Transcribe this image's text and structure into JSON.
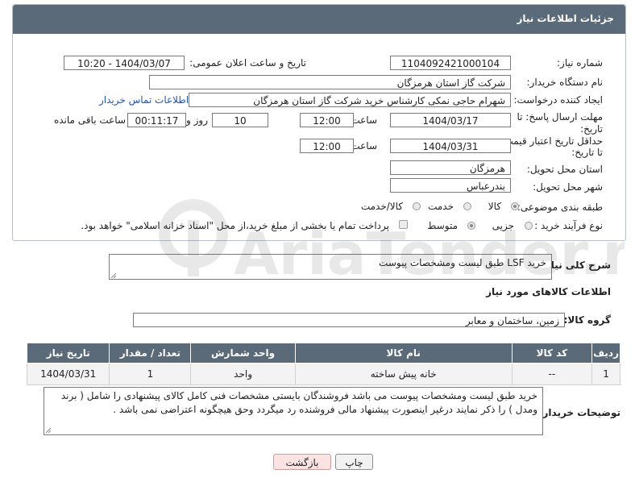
{
  "header": {
    "title": "جزئیات اطلاعات نیاز"
  },
  "fields": {
    "need_number_label": "شماره نیاز:",
    "need_number": "1104092421000104",
    "announce_label": "تاریخ و ساعت اعلان عمومی:",
    "announce_value": "1404/03/07 - 10:20",
    "buyer_org_label": "نام دستگاه خریدار:",
    "buyer_org": "شرکت گاز استان هرمزگان",
    "creator_label": "ایجاد کننده درخواست:",
    "creator": "شهرام حاجی نمکی کارشناس خرید شرکت گاز استان هرمزگان",
    "contact_link": "اطلاعات تماس خریدار",
    "deadline_label_1": "مهلت ارسال پاسخ: تا",
    "deadline_label_2": "تاریخ:",
    "deadline_date": "1404/03/17",
    "time_label": "ساعت",
    "deadline_time": "12:00",
    "days_value": "10",
    "days_label": "روز و",
    "remaining_value": "00:11:17",
    "remaining_label": "ساعت باقی مانده",
    "validity_label_1": "حداقل تاریخ اعتبار قیمت:",
    "validity_label_2": "تا تاریخ:",
    "validity_date": "1404/03/31",
    "validity_time": "12:00",
    "province_label": "استان محل تحویل:",
    "province": "هرمزگان",
    "city_label": "شهر محل تحویل:",
    "city": "بندرعباس",
    "category_label": "طبقه بندی موضوعی:",
    "category_options": [
      "کالا",
      "خدمت",
      "کالا/خدمت"
    ],
    "category_selected": "کالا",
    "process_label": "نوع فرآیند خرید :",
    "process_options": [
      "جزیی",
      "متوسط"
    ],
    "process_selected": "متوسط",
    "payment_text": "پرداخت تمام یا بخشی از مبلغ خرید،از محل \"اسناد خزانه اسلامی\" خواهد بود."
  },
  "description": {
    "label": "شرح کلی نیاز:",
    "value": "خرید LSF  طبق لیست ومشخصات پیوست"
  },
  "goods_info": {
    "title": "اطلاعات کالاهای مورد نیاز",
    "group_label": "گروه کالا:",
    "group_value": "زمین، ساختمان و معابر"
  },
  "table": {
    "headers": [
      "ردیف",
      "کد کالا",
      "نام کالا",
      "واحد شمارش",
      "تعداد / مقدار",
      "تاریخ نیاز"
    ],
    "rows": [
      [
        "1",
        "--",
        "خانه پیش ساخته",
        "واحد",
        "1",
        "1404/03/31"
      ]
    ]
  },
  "buyer_notes": {
    "label": "توضیحات خریدار:",
    "value": "خرید طبق لیست ومشخصات پیوست می باشد فروشندگان بایستی مشخصات فنی کامل کالای پیشنهادی را شامل ( برند ومدل ) را ذکر نمایند درغیر اینصورت پیشنهاد مالی فروشنده رد میگردد وحق هیچگونه اعتراضی نمی باشد ."
  },
  "buttons": {
    "print": "چاپ",
    "back": "بازگشت"
  },
  "watermark": "AriaTender.net",
  "colors": {
    "header_bg": "#5a6a78",
    "link": "#1a53c9",
    "back_bg": "#fbe3e3"
  }
}
